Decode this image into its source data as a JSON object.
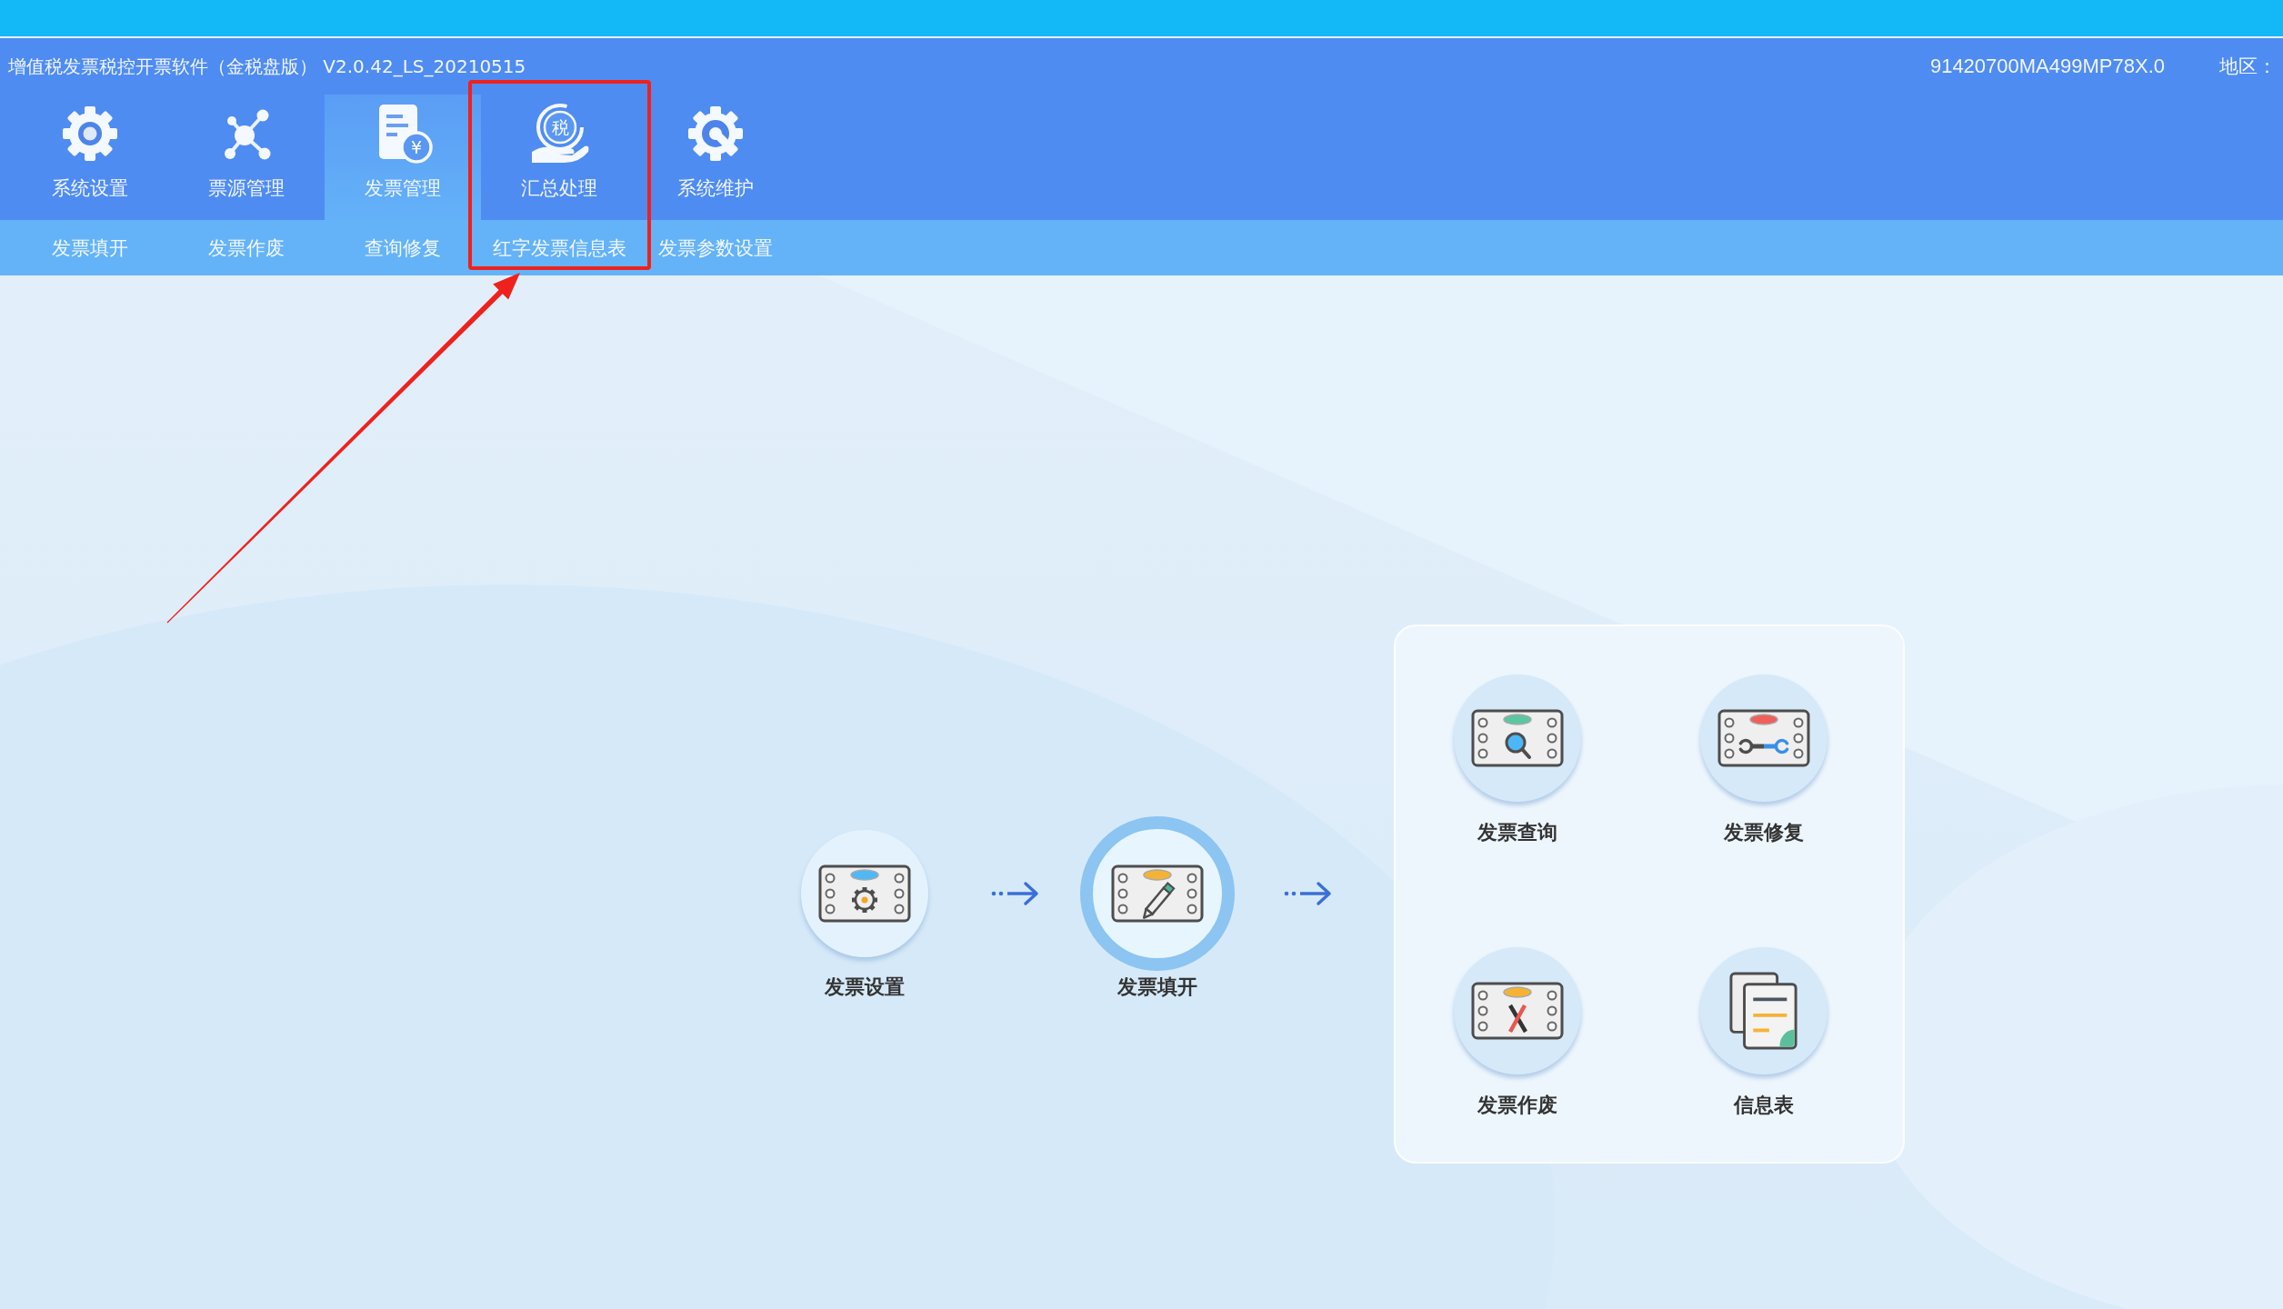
{
  "window": {
    "title": "增值税发票税控开票软件（金税盘版） V2.0.42_LS_20210515",
    "tax_number": "91420700MA499MP78X.0",
    "region_label": "地区："
  },
  "toolbar": [
    {
      "label": "系统设置",
      "selected": false,
      "highlighted": false
    },
    {
      "label": "票源管理",
      "selected": false,
      "highlighted": false
    },
    {
      "label": "发票管理",
      "selected": true,
      "highlighted": false,
      "icon_text": "¥"
    },
    {
      "label": "汇总处理",
      "selected": false,
      "highlighted": true,
      "icon_text": "税"
    },
    {
      "label": "系统维护",
      "selected": false,
      "highlighted": false
    }
  ],
  "submenu": [
    {
      "label": "发票填开"
    },
    {
      "label": "发票作废"
    },
    {
      "label": "查询修复"
    },
    {
      "label": "红字发票信息表"
    },
    {
      "label": "发票参数设置"
    }
  ],
  "workflow": {
    "steps": [
      {
        "label": "发票设置",
        "selected": false
      },
      {
        "label": "发票填开",
        "selected": true
      }
    ],
    "functions": [
      {
        "label": "发票查询"
      },
      {
        "label": "发票修复"
      },
      {
        "label": "发票作废"
      },
      {
        "label": "信息表"
      }
    ]
  }
}
